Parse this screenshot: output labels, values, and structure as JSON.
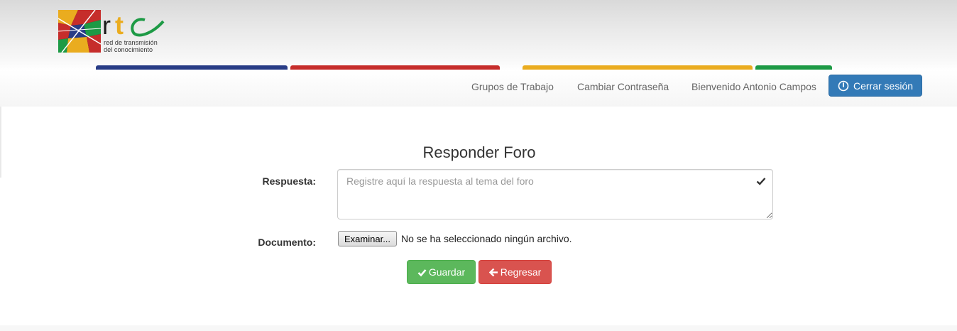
{
  "brand": {
    "logo_text": "rtc",
    "caption_line1": "red de transmisión",
    "caption_line2": "del conocimiento"
  },
  "colors": {
    "bar_blue": "#283c86",
    "bar_red": "#c62d2b",
    "bar_yellow": "#eaac1f",
    "bar_green": "#1d9a45",
    "primary": "#337ab7",
    "success": "#5cb85c",
    "danger": "#d9534f"
  },
  "nav": {
    "groups": "Grupos de Trabajo",
    "change_password": "Cambiar Contraseña",
    "welcome": "Bienvenido Antonio Campos",
    "logout": "Cerrar sesión",
    "logout_icon": "power-icon"
  },
  "form": {
    "title": "Responder Foro",
    "response_label": "Respuesta:",
    "response_placeholder": "Registre aquí la respuesta al tema del foro",
    "response_value": "",
    "document_label": "Documento:",
    "file_button": "Examinar...",
    "file_status": "No se ha seleccionado ningún archivo.",
    "save": "Guardar",
    "save_icon": "check-icon",
    "back": "Regresar",
    "back_icon": "arrow-left-icon"
  }
}
